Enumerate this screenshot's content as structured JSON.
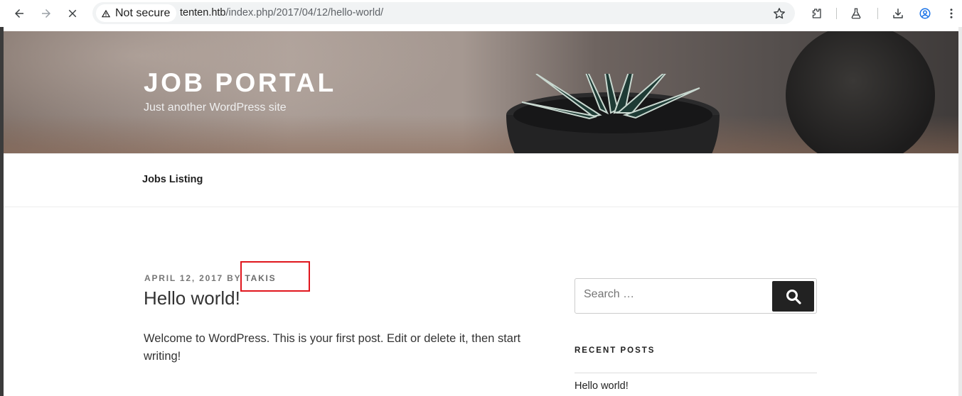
{
  "browser": {
    "security_label": "Not secure",
    "url_host": "tenten.htb",
    "url_path": "/index.php/2017/04/12/hello-world/",
    "icons": [
      "back-icon",
      "forward-icon",
      "stop-icon",
      "warning-icon",
      "star-icon",
      "extensions-icon",
      "labs-icon",
      "download-icon",
      "profile-icon",
      "menu-icon"
    ]
  },
  "site": {
    "title": "JOB PORTAL",
    "description": "Just another WordPress site"
  },
  "menu": {
    "items": [
      {
        "label": "Jobs Listing"
      }
    ]
  },
  "post": {
    "date": "APRIL 12, 2017",
    "by": "BY",
    "author": "TAKIS",
    "title": "Hello world!",
    "body": "Welcome to WordPress. This is your first post. Edit or delete it, then start writing!"
  },
  "sidebar": {
    "search_placeholder": "Search …",
    "recent_posts_title": "RECENT POSTS",
    "recent_posts": [
      "Hello world!"
    ]
  },
  "colors": {
    "highlight_box": "#e0161d",
    "search_button": "#222222"
  }
}
